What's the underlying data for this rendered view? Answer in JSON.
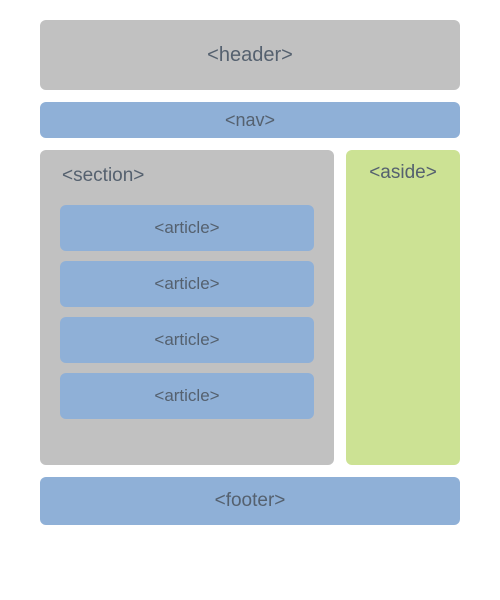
{
  "layout": {
    "header": "<header>",
    "nav": "<nav>",
    "section_label": "<section>",
    "articles": [
      "<article>",
      "<article>",
      "<article>",
      "<article>"
    ],
    "aside": "<aside>",
    "footer": "<footer>"
  },
  "colors": {
    "gray": "#c1c1c1",
    "blue": "#8fb0d7",
    "green": "#cce294",
    "text": "#55616f"
  }
}
